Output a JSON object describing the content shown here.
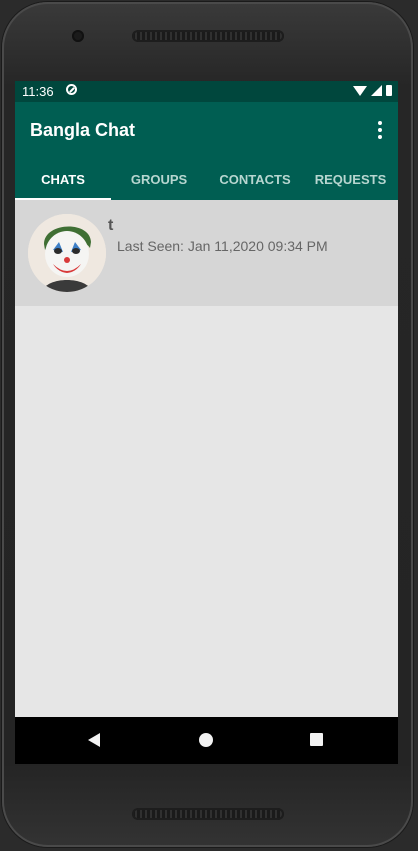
{
  "status_bar": {
    "time": "11:36"
  },
  "app_bar": {
    "title": "Bangla Chat"
  },
  "tabs": [
    {
      "label": "CHATS",
      "active": true
    },
    {
      "label": "GROUPS",
      "active": false
    },
    {
      "label": "CONTACTS",
      "active": false
    },
    {
      "label": "REQUESTS",
      "active": false
    }
  ],
  "chats": [
    {
      "name": "t",
      "status": "Last Seen: Jan 11,2020 09:34 PM"
    }
  ],
  "colors": {
    "status_bar": "#00473d",
    "app_bar": "#005e52",
    "content_background": "#e6e6e6",
    "chat_row_background": "#d6d6d6"
  },
  "icons": {
    "status": [
      "sync-icon",
      "wifi-icon",
      "signal-icon",
      "battery-icon"
    ],
    "app_bar": [
      "overflow-menu-icon"
    ],
    "navigation": [
      "back-icon",
      "home-icon",
      "recents-icon"
    ]
  }
}
